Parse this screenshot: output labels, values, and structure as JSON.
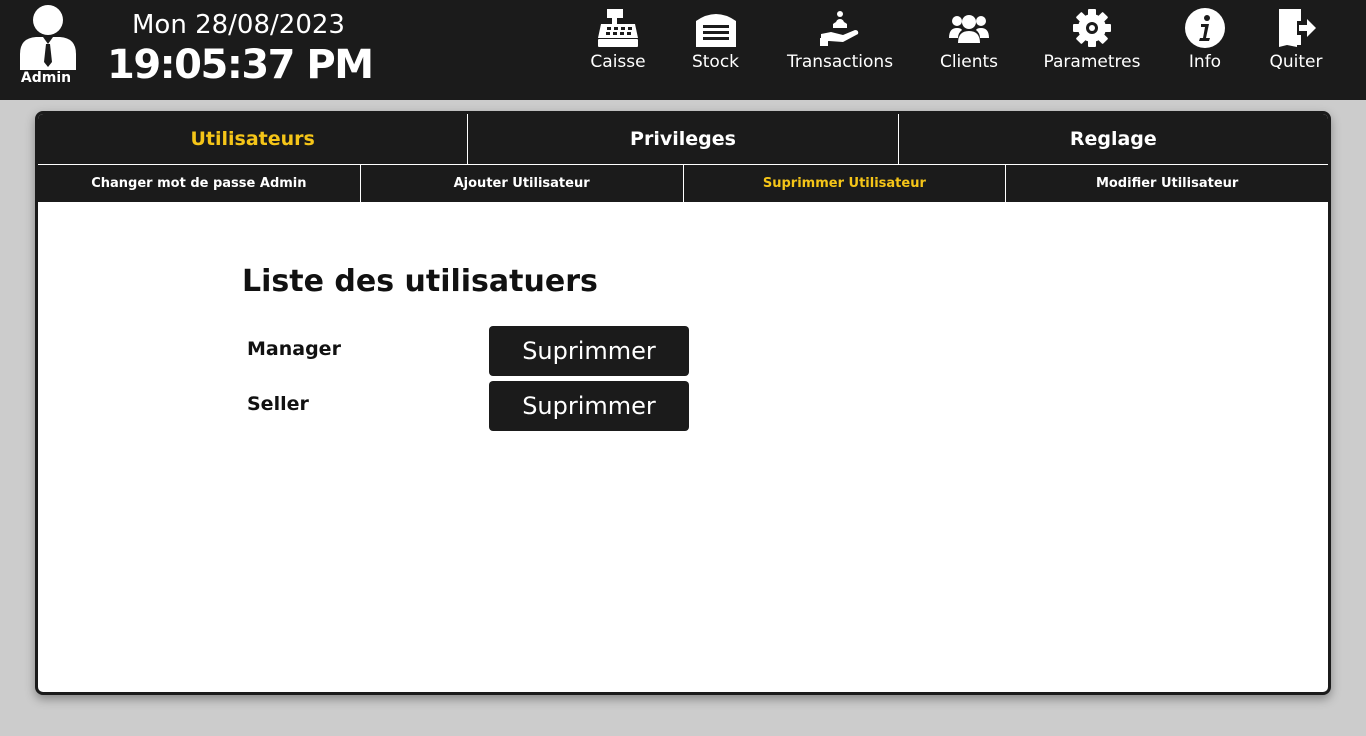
{
  "header": {
    "user_label": "Admin",
    "date": "Mon 28/08/2023",
    "time": "19:05:37 PM",
    "nav": [
      {
        "label": "Caisse",
        "icon": "cash-register-icon"
      },
      {
        "label": "Stock",
        "icon": "warehouse-icon"
      },
      {
        "label": "Transactions",
        "icon": "hand-coin-icon"
      },
      {
        "label": "Clients",
        "icon": "users-icon"
      },
      {
        "label": "Parametres",
        "icon": "gear-icon"
      },
      {
        "label": "Info",
        "icon": "info-icon"
      },
      {
        "label": "Quiter",
        "icon": "exit-door-icon"
      }
    ]
  },
  "tabs": [
    {
      "label": "Utilisateurs",
      "active": true
    },
    {
      "label": "Privileges",
      "active": false
    },
    {
      "label": "Reglage",
      "active": false
    }
  ],
  "subtabs": [
    {
      "label": "Changer mot de passe Admin",
      "active": false
    },
    {
      "label": "Ajouter Utilisateur",
      "active": false
    },
    {
      "label": "Suprimmer Utilisateur",
      "active": true
    },
    {
      "label": "Modifier Utilisateur",
      "active": false
    }
  ],
  "content": {
    "title": "Liste des utilisatuers",
    "users": [
      {
        "name": "Manager",
        "button_label": "Suprimmer"
      },
      {
        "name": "Seller",
        "button_label": "Suprimmer"
      }
    ]
  },
  "colors": {
    "bar": "#1b1b1b",
    "accent": "#f5c518",
    "background": "#cccccc"
  }
}
